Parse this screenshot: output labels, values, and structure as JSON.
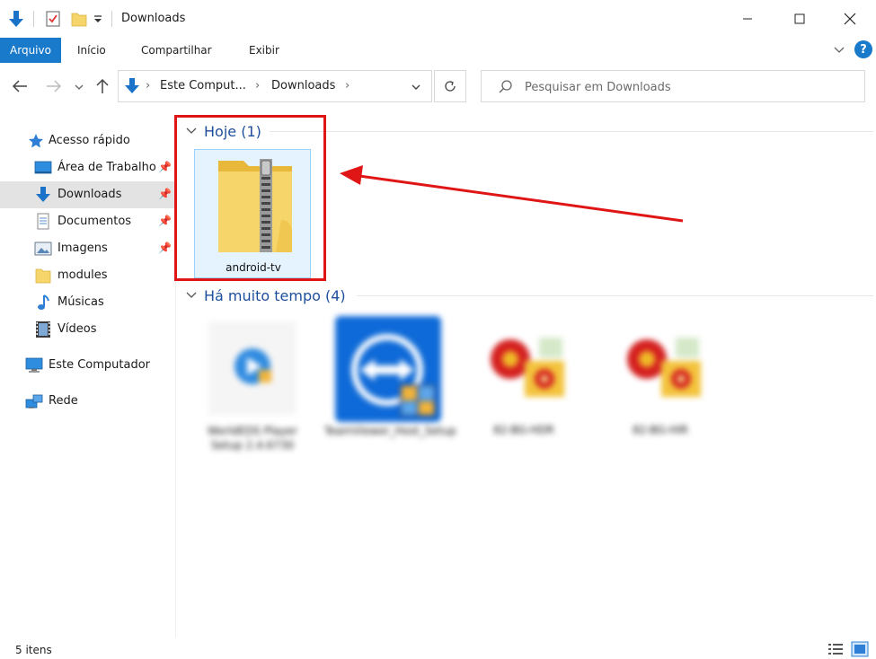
{
  "window": {
    "title": "Downloads"
  },
  "ribbon": {
    "tabs": [
      "Arquivo",
      "Início",
      "Compartilhar",
      "Exibir"
    ]
  },
  "address": {
    "segments": [
      "Este Comput...",
      "Downloads"
    ]
  },
  "search": {
    "placeholder": "Pesquisar em Downloads"
  },
  "sidebar": {
    "items": [
      {
        "label": "Acesso rápido",
        "icon": "star-icon"
      },
      {
        "label": "Área de Trabalho",
        "icon": "desktop-icon",
        "pinned": true
      },
      {
        "label": "Downloads",
        "icon": "download-arrow-icon",
        "pinned": true,
        "selected": true
      },
      {
        "label": "Documentos",
        "icon": "document-icon",
        "pinned": true
      },
      {
        "label": "Imagens",
        "icon": "image-icon",
        "pinned": true
      },
      {
        "label": "modules",
        "icon": "folder-icon"
      },
      {
        "label": "Músicas",
        "icon": "music-note-icon"
      },
      {
        "label": "Vídeos",
        "icon": "film-icon"
      },
      {
        "label": "Este Computador",
        "icon": "computer-icon"
      },
      {
        "label": "Rede",
        "icon": "network-icon"
      }
    ]
  },
  "groups": {
    "today": {
      "label": "Hoje (1)"
    },
    "older": {
      "label": "Há muito tempo (4)"
    }
  },
  "files": {
    "today": [
      {
        "name": "android-tv",
        "icon": "zip-folder-icon"
      }
    ],
    "older": [
      {
        "name": "WorldEDS Player Setup 2.4.6730",
        "icon": "media-player-setup-icon"
      },
      {
        "name": "TeamViewer_Host_Setup",
        "icon": "teamviewer-icon"
      },
      {
        "name": "82-BG-HDR",
        "icon": "image-file-icon"
      },
      {
        "name": "82-BG-HIR",
        "icon": "image-file-icon"
      }
    ]
  },
  "status": {
    "items_count": "5 itens"
  },
  "colors": {
    "accent": "#1979ca",
    "group_header": "#1e4f9c",
    "annotation_red": "#e01616",
    "folder_yellow": "#f6d56b"
  }
}
